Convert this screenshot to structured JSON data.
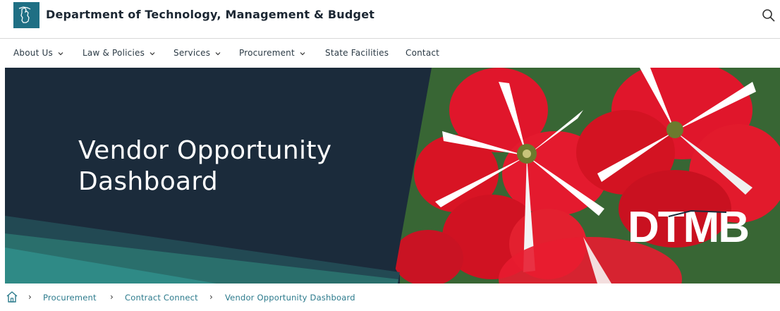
{
  "header": {
    "site_title": "Department of Technology, Management & Budget",
    "logo_icon": "michigan-state-icon",
    "search_icon": "search-icon",
    "brand_color": "#1f6f84"
  },
  "nav": {
    "items": [
      {
        "label": "About Us",
        "has_dropdown": true
      },
      {
        "label": "Law & Policies",
        "has_dropdown": true
      },
      {
        "label": "Services",
        "has_dropdown": true
      },
      {
        "label": "Procurement",
        "has_dropdown": true
      },
      {
        "label": "State Facilities",
        "has_dropdown": false
      },
      {
        "label": "Contact",
        "has_dropdown": false
      }
    ]
  },
  "hero": {
    "title": "Vendor Opportunity Dashboard",
    "logo_text": "DTMB",
    "panel_color": "#1b2b3b",
    "accent_color": "#2f8a86"
  },
  "breadcrumb": {
    "home_icon": "home-icon",
    "items": [
      "Procurement",
      "Contract Connect",
      "Vendor Opportunity Dashboard"
    ]
  }
}
